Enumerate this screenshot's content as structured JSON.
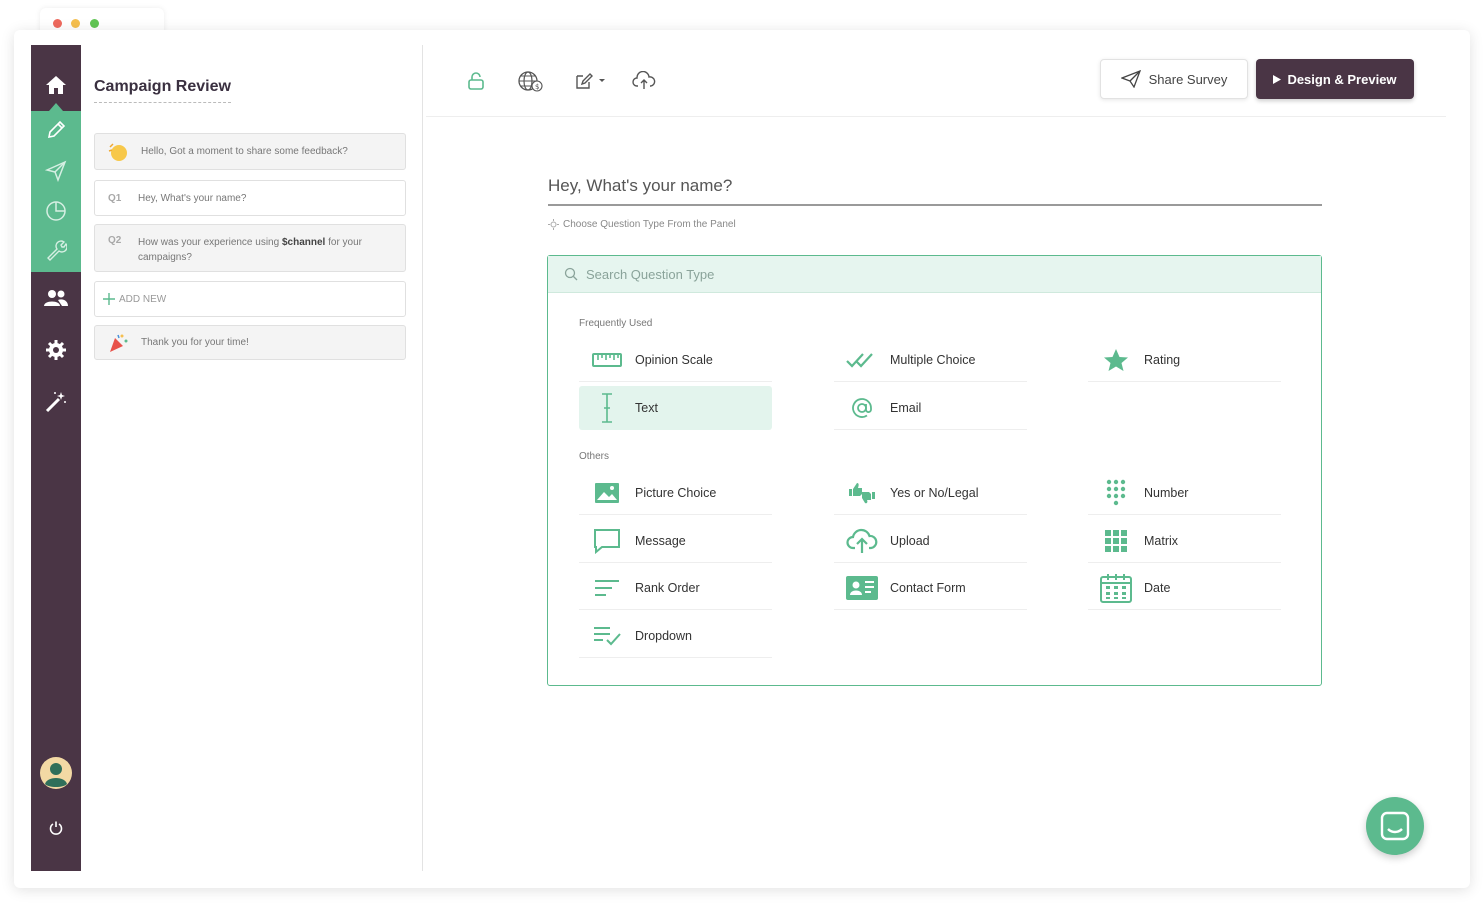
{
  "app": {
    "campaign_title": "Campaign Review"
  },
  "sidebar": {
    "cards": [
      {
        "type": "welcome",
        "icon": "waving-hand-icon",
        "text": "Hello, Got a moment to share some feedback?"
      },
      {
        "type": "question",
        "number": "Q1",
        "text": "Hey, What's your name?"
      },
      {
        "type": "question",
        "number": "Q2",
        "text_before": "How was your experience using ",
        "text_bold": "$channel",
        "text_after": " for your campaigns?"
      },
      {
        "type": "add",
        "icon": "plus-icon",
        "text": "ADD NEW"
      },
      {
        "type": "thankyou",
        "icon": "party-popper-icon",
        "text": "Thank you for your time!"
      }
    ]
  },
  "toolbar": {
    "share_label": "Share Survey",
    "design_label": "Design & Preview"
  },
  "main": {
    "question_title": "Hey, What's your name?",
    "hint": "Choose Question Type From the Panel",
    "search_placeholder": "Search Question Type",
    "frequent_label": "Frequently Used",
    "others_label": "Others",
    "frequent": [
      {
        "label": "Opinion Scale",
        "icon": "ruler-icon"
      },
      {
        "label": "Multiple Choice",
        "icon": "double-check-icon"
      },
      {
        "label": "Rating",
        "icon": "star-icon"
      },
      {
        "label": "Text",
        "icon": "text-cursor-icon",
        "selected": true
      },
      {
        "label": "Email",
        "icon": "at-icon"
      }
    ],
    "others": [
      {
        "label": "Picture Choice",
        "icon": "image-icon"
      },
      {
        "label": "Yes or No/Legal",
        "icon": "thumbs-up-down-icon"
      },
      {
        "label": "Number",
        "icon": "number-dots-icon"
      },
      {
        "label": "Message",
        "icon": "message-icon"
      },
      {
        "label": "Upload",
        "icon": "cloud-upload-icon"
      },
      {
        "label": "Matrix",
        "icon": "matrix-icon"
      },
      {
        "label": "Rank Order",
        "icon": "rank-lines-icon"
      },
      {
        "label": "Contact Form",
        "icon": "contact-card-icon"
      },
      {
        "label": "Date",
        "icon": "calendar-icon"
      },
      {
        "label": "Dropdown",
        "icon": "dropdown-list-icon"
      }
    ]
  },
  "colors": {
    "accent": "#5cba8e",
    "rail": "#4a3545",
    "dark_button": "#4a3545"
  }
}
